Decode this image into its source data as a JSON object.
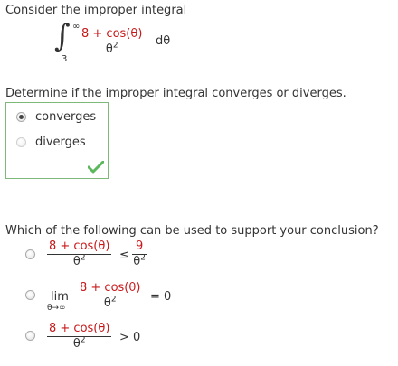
{
  "question1": {
    "prompt": "Consider the improper integral",
    "integral": {
      "upper_limit": "∞",
      "lower_limit": "3",
      "numerator": "8 + cos(θ)",
      "denominator_base": "θ",
      "denominator_exp": "2",
      "differential": "dθ"
    },
    "ask": "Determine if the improper integral converges or diverges.",
    "options": [
      {
        "label": "converges",
        "selected": true
      },
      {
        "label": "diverges",
        "selected": false
      }
    ],
    "status": "correct"
  },
  "question2": {
    "prompt": "Which of the following can be used to support your conclusion?",
    "option1": {
      "left_numerator": "8 + cos(θ)",
      "left_den_base": "θ",
      "left_den_exp": "2",
      "relation": "≤",
      "right_numerator": "9",
      "right_den_base": "θ",
      "right_den_exp": "2"
    },
    "option2": {
      "lim": "lim",
      "lim_sub": "θ→∞",
      "numerator": "8 + cos(θ)",
      "den_base": "θ",
      "den_exp": "2",
      "relation": "= 0"
    },
    "option3": {
      "numerator": "8 + cos(θ)",
      "den_base": "θ",
      "den_exp": "2",
      "relation": "> 0"
    }
  },
  "colors": {
    "answer_highlight": "#c8191a",
    "correct_border": "#7fb97a",
    "checkmark": "#5cb85c"
  }
}
